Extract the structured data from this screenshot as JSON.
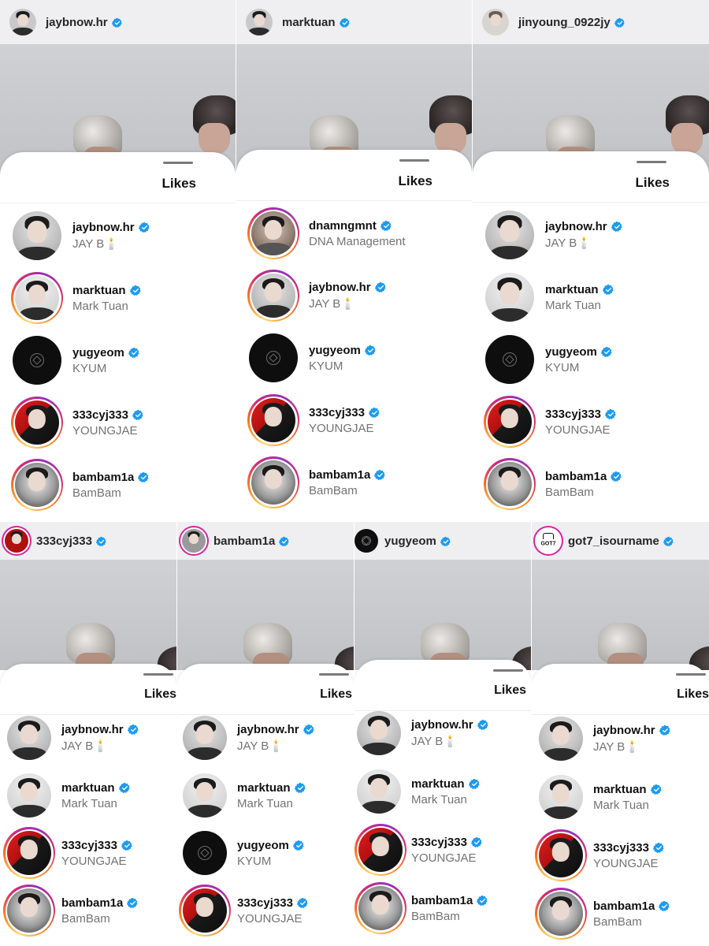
{
  "colors": {
    "verified": "#1d9bf0",
    "topbar": "#efeff1",
    "ring": "#d6249f"
  },
  "sheet_title": "Likes",
  "panels": [
    {
      "account": "jaybnow.hr",
      "rows": [
        {
          "username": "jaybnow.hr",
          "display": "JAY B🕯️"
        },
        {
          "username": "marktuan",
          "display": "Mark Tuan"
        },
        {
          "username": "yugyeom",
          "display": "KYUM"
        },
        {
          "username": "333cyj333",
          "display": "YOUNGJAE"
        },
        {
          "username": "bambam1a",
          "display": "BamBam"
        }
      ]
    },
    {
      "account": "marktuan",
      "rows": [
        {
          "username": "dnamngmnt",
          "display": "DNA Management"
        },
        {
          "username": "jaybnow.hr",
          "display": "JAY B🕯️"
        },
        {
          "username": "yugyeom",
          "display": "KYUM"
        },
        {
          "username": "333cyj333",
          "display": "YOUNGJAE"
        },
        {
          "username": "bambam1a",
          "display": "BamBam"
        }
      ]
    },
    {
      "account": "jinyoung_0922jy",
      "rows": [
        {
          "username": "jaybnow.hr",
          "display": "JAY B🕯️"
        },
        {
          "username": "marktuan",
          "display": "Mark Tuan"
        },
        {
          "username": "yugyeom",
          "display": "KYUM"
        },
        {
          "username": "333cyj333",
          "display": "YOUNGJAE"
        },
        {
          "username": "bambam1a",
          "display": "BamBam"
        }
      ]
    },
    {
      "account": "333cyj333",
      "rows": [
        {
          "username": "jaybnow.hr",
          "display": "JAY B🕯️"
        },
        {
          "username": "marktuan",
          "display": "Mark Tuan"
        },
        {
          "username": "333cyj333",
          "display": "YOUNGJAE"
        },
        {
          "username": "bambam1a",
          "display": "BamBam"
        }
      ]
    },
    {
      "account": "bambam1a",
      "rows": [
        {
          "username": "jaybnow.hr",
          "display": "JAY B🕯️"
        },
        {
          "username": "marktuan",
          "display": "Mark Tuan"
        },
        {
          "username": "yugyeom",
          "display": "KYUM"
        },
        {
          "username": "333cyj333",
          "display": "YOUNGJAE"
        }
      ]
    },
    {
      "account": "yugyeom",
      "rows": [
        {
          "username": "jaybnow.hr",
          "display": "JAY B🕯️"
        },
        {
          "username": "marktuan",
          "display": "Mark Tuan"
        },
        {
          "username": "333cyj333",
          "display": "YOUNGJAE"
        },
        {
          "username": "bambam1a",
          "display": "BamBam"
        }
      ]
    },
    {
      "account": "got7_isourname",
      "logo_text": "GOT7",
      "rows": [
        {
          "username": "jaybnow.hr",
          "display": "JAY B🕯️"
        },
        {
          "username": "marktuan",
          "display": "Mark Tuan"
        },
        {
          "username": "333cyj333",
          "display": "YOUNGJAE"
        },
        {
          "username": "bambam1a",
          "display": "BamBam"
        }
      ]
    }
  ]
}
